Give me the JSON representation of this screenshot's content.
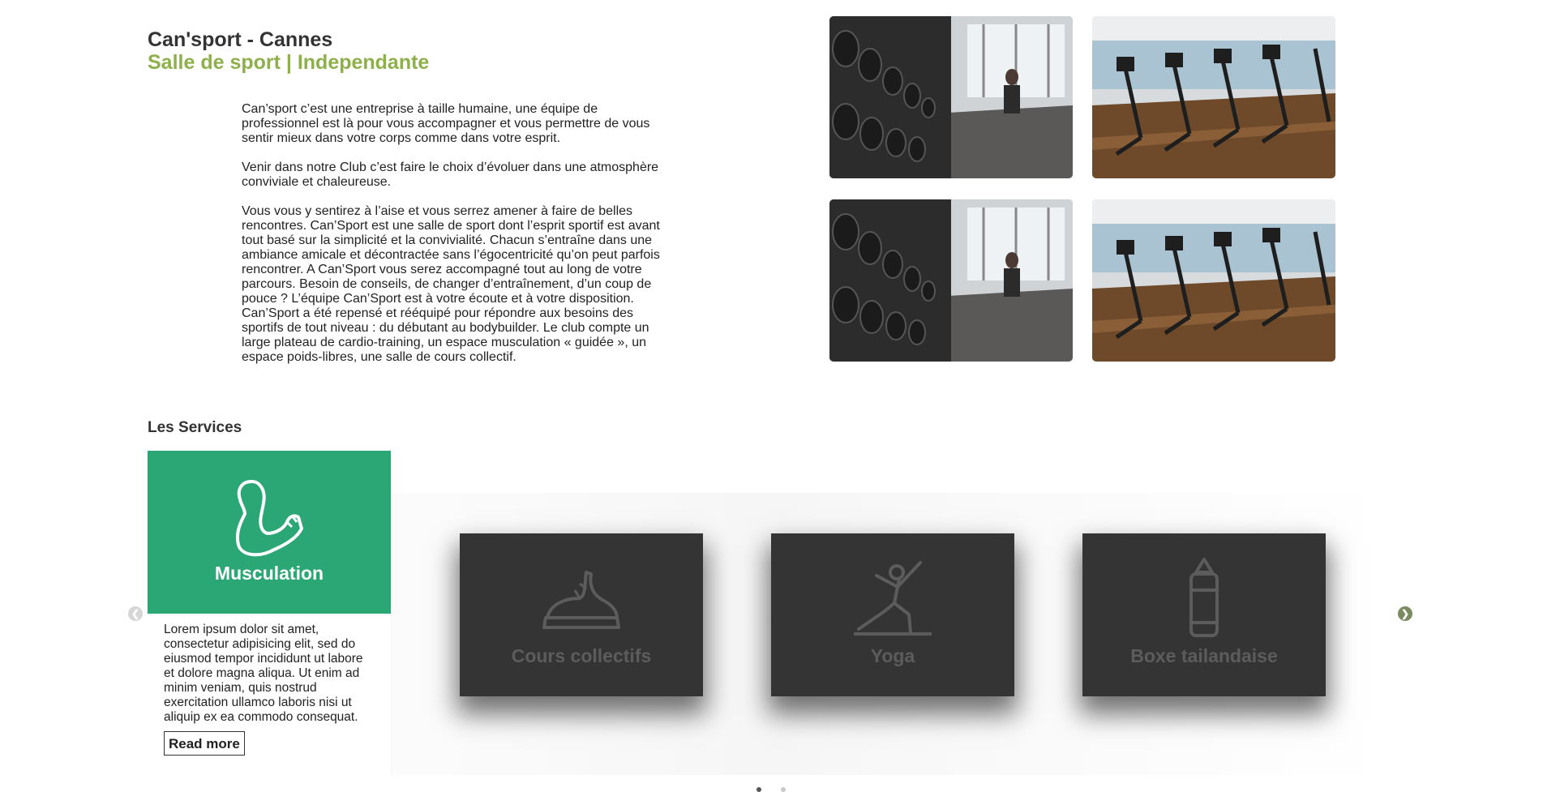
{
  "header": {
    "title": "Can'sport - Cannes",
    "subtitle": "Salle de sport | Independante"
  },
  "intro": {
    "paragraphs": [
      "Can’sport c’est une entreprise à taille humaine, une équipe de professionnel est là pour vous accompagner et vous permettre de vous sentir mieux dans votre corps comme dans votre esprit.",
      "Venir dans notre Club c’est faire le choix d’évoluer dans une atmosphère conviviale et chaleureuse.",
      "Vous vous y sentirez à l’aise et vous serrez amener à faire de belles rencontres. Can’Sport est une salle de sport dont l’esprit sportif est avant tout basé sur la simplicité et la convivialité. Chacun s’entraîne dans une ambiance amicale et décontractée sans l’égocentricité qu’on peut parfois rencontrer. A Can’Sport vous serez accompagné tout au long de votre parcours. Besoin de conseils, de changer d’entraînement, d’un coup de pouce ? L’équipe Can’Sport est à votre écoute et à votre disposition. Can’Sport a été repensé et rééquipé pour répondre aux besoins des sportifs de tout niveau : du débutant au bodybuilder. Le club compte un large plateau de cardio-training, un espace musculation « guidée », un espace poids-libres, une salle de cours collectif."
    ]
  },
  "gallery": {
    "images": [
      {
        "icon": "dumbbell-rack-photo"
      },
      {
        "icon": "cardio-machines-photo"
      },
      {
        "icon": "dumbbell-rack-photo"
      },
      {
        "icon": "cardio-machines-photo"
      }
    ]
  },
  "services": {
    "heading": "Les Services",
    "active_card": {
      "label": "Musculation",
      "icon": "flexed-arm-icon",
      "description": "Lorem ipsum dolor sit amet, consectetur adipisicing elit, sed do eiusmod tempor incididunt ut labore et dolore magna aliqua. Ut enim ad minim veniam, quis nostrud exercitation ullamco laboris nisi ut aliquip ex ea commodo consequat.",
      "read_more": "Read more"
    },
    "cards": [
      {
        "label": "Cours collectifs",
        "icon": "step-sneaker-icon"
      },
      {
        "label": "Yoga",
        "icon": "yoga-pose-icon"
      },
      {
        "label": "Boxe tailandaise",
        "icon": "punching-bag-icon"
      }
    ],
    "colors": {
      "active": "#2aa775",
      "inactive": "#343434",
      "accent": "#8db04a"
    },
    "pager": {
      "pages": 2,
      "current": 1
    }
  }
}
